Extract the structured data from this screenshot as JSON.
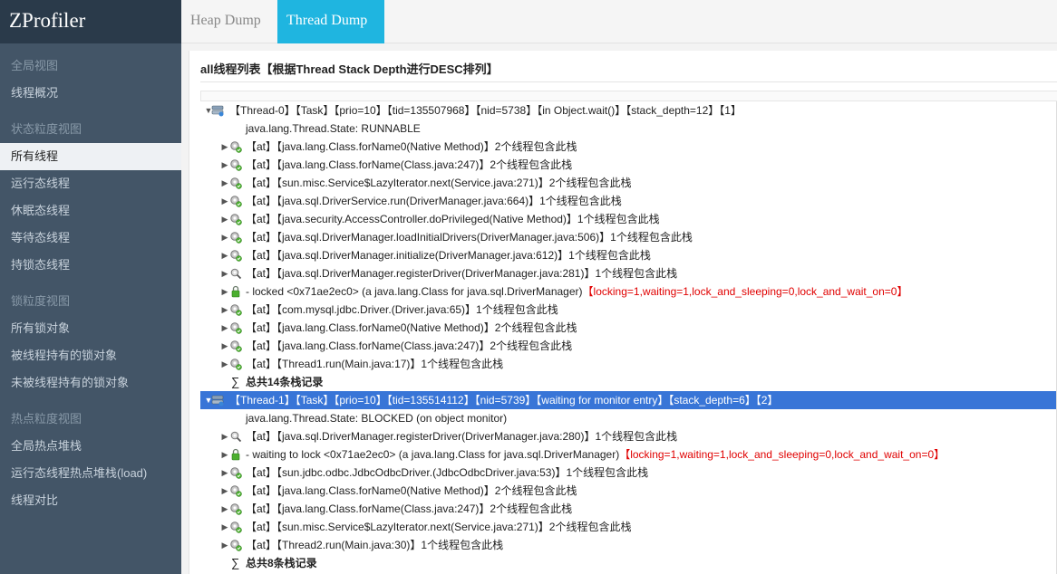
{
  "app": {
    "brand": "ZProfiler"
  },
  "tabs": [
    {
      "label": "Heap Dump",
      "active": false
    },
    {
      "label": "Thread Dump",
      "active": true
    }
  ],
  "sidebar": {
    "sections": [
      {
        "header": "全局视图",
        "items": [
          {
            "label": "线程概况",
            "active": false
          }
        ]
      },
      {
        "header": "状态粒度视图",
        "items": [
          {
            "label": "所有线程",
            "active": true
          },
          {
            "label": "运行态线程",
            "active": false
          },
          {
            "label": "休眠态线程",
            "active": false
          },
          {
            "label": "等待态线程",
            "active": false
          },
          {
            "label": "持锁态线程",
            "active": false
          }
        ]
      },
      {
        "header": "锁粒度视图",
        "items": [
          {
            "label": "所有锁对象",
            "active": false
          },
          {
            "label": "被线程持有的锁对象",
            "active": false
          },
          {
            "label": "未被线程持有的锁对象",
            "active": false
          }
        ]
      },
      {
        "header": "热点粒度视图",
        "items": [
          {
            "label": "全局热点堆栈",
            "active": false
          },
          {
            "label": "运行态线程热点堆栈(load)",
            "active": false
          },
          {
            "label": "线程对比",
            "active": false
          }
        ]
      }
    ]
  },
  "main": {
    "title": "all线程列表【根据Thread Stack Depth进行DESC排列】",
    "threads": [
      {
        "header": "【Thread-0】【Task】【prio=10】【tid=135507968】【nid=5738】【in Object.wait()】【stack_depth=12】【1】",
        "selected": false,
        "state": "java.lang.Thread.State: RUNNABLE",
        "frames": [
          {
            "icon": "gear",
            "text": "【at】【java.lang.Class.forName0(Native Method)】2个线程包含此栈",
            "red": ""
          },
          {
            "icon": "gear",
            "text": "【at】【java.lang.Class.forName(Class.java:247)】2个线程包含此栈",
            "red": ""
          },
          {
            "icon": "gear",
            "text": "【at】【sun.misc.Service$LazyIterator.next(Service.java:271)】2个线程包含此栈",
            "red": ""
          },
          {
            "icon": "gear",
            "text": "【at】【java.sql.DriverService.run(DriverManager.java:664)】1个线程包含此栈",
            "red": ""
          },
          {
            "icon": "gear",
            "text": "【at】【java.security.AccessController.doPrivileged(Native Method)】1个线程包含此栈",
            "red": ""
          },
          {
            "icon": "gear",
            "text": "【at】【java.sql.DriverManager.loadInitialDrivers(DriverManager.java:506)】1个线程包含此栈",
            "red": ""
          },
          {
            "icon": "gear",
            "text": "【at】【java.sql.DriverManager.initialize(DriverManager.java:612)】1个线程包含此栈",
            "red": ""
          },
          {
            "icon": "search-gear",
            "text": "【at】【java.sql.DriverManager.registerDriver(DriverManager.java:281)】1个线程包含此栈",
            "red": ""
          },
          {
            "icon": "lock",
            "text": "- locked <0x71ae2ec0> (a java.lang.Class for java.sql.DriverManager)",
            "red": "【locking=1,waiting=1,lock_and_sleeping=0,lock_and_wait_on=0】"
          },
          {
            "icon": "gear",
            "text": "【at】【com.mysql.jdbc.Driver.(Driver.java:65)】1个线程包含此栈",
            "red": ""
          },
          {
            "icon": "gear",
            "text": "【at】【java.lang.Class.forName0(Native Method)】2个线程包含此栈",
            "red": ""
          },
          {
            "icon": "gear",
            "text": "【at】【java.lang.Class.forName(Class.java:247)】2个线程包含此栈",
            "red": ""
          },
          {
            "icon": "gear",
            "text": "【at】【Thread1.run(Main.java:17)】1个线程包含此栈",
            "red": ""
          }
        ],
        "summary": "总共14条栈记录"
      },
      {
        "header": "【Thread-1】【Task】【prio=10】【tid=135514112】【nid=5739】【waiting for monitor entry】【stack_depth=6】【2】",
        "selected": true,
        "state": "java.lang.Thread.State: BLOCKED (on object monitor)",
        "frames": [
          {
            "icon": "search-gear",
            "text": "【at】【java.sql.DriverManager.registerDriver(DriverManager.java:280)】1个线程包含此栈",
            "red": ""
          },
          {
            "icon": "lock",
            "text": "- waiting to lock <0x71ae2ec0> (a java.lang.Class for java.sql.DriverManager)",
            "red": "【locking=1,waiting=1,lock_and_sleeping=0,lock_and_wait_on=0】"
          },
          {
            "icon": "gear",
            "text": "【at】【sun.jdbc.odbc.JdbcOdbcDriver.(JdbcOdbcDriver.java:53)】1个线程包含此栈",
            "red": ""
          },
          {
            "icon": "gear",
            "text": "【at】【java.lang.Class.forName0(Native Method)】2个线程包含此栈",
            "red": ""
          },
          {
            "icon": "gear",
            "text": "【at】【java.lang.Class.forName(Class.java:247)】2个线程包含此栈",
            "red": ""
          },
          {
            "icon": "gear",
            "text": "【at】【sun.misc.Service$LazyIterator.next(Service.java:271)】2个线程包含此栈",
            "red": ""
          },
          {
            "icon": "gear",
            "text": "【at】【Thread2.run(Main.java:30)】1个线程包含此栈",
            "red": ""
          }
        ],
        "summary": "总共8条栈记录"
      }
    ]
  }
}
